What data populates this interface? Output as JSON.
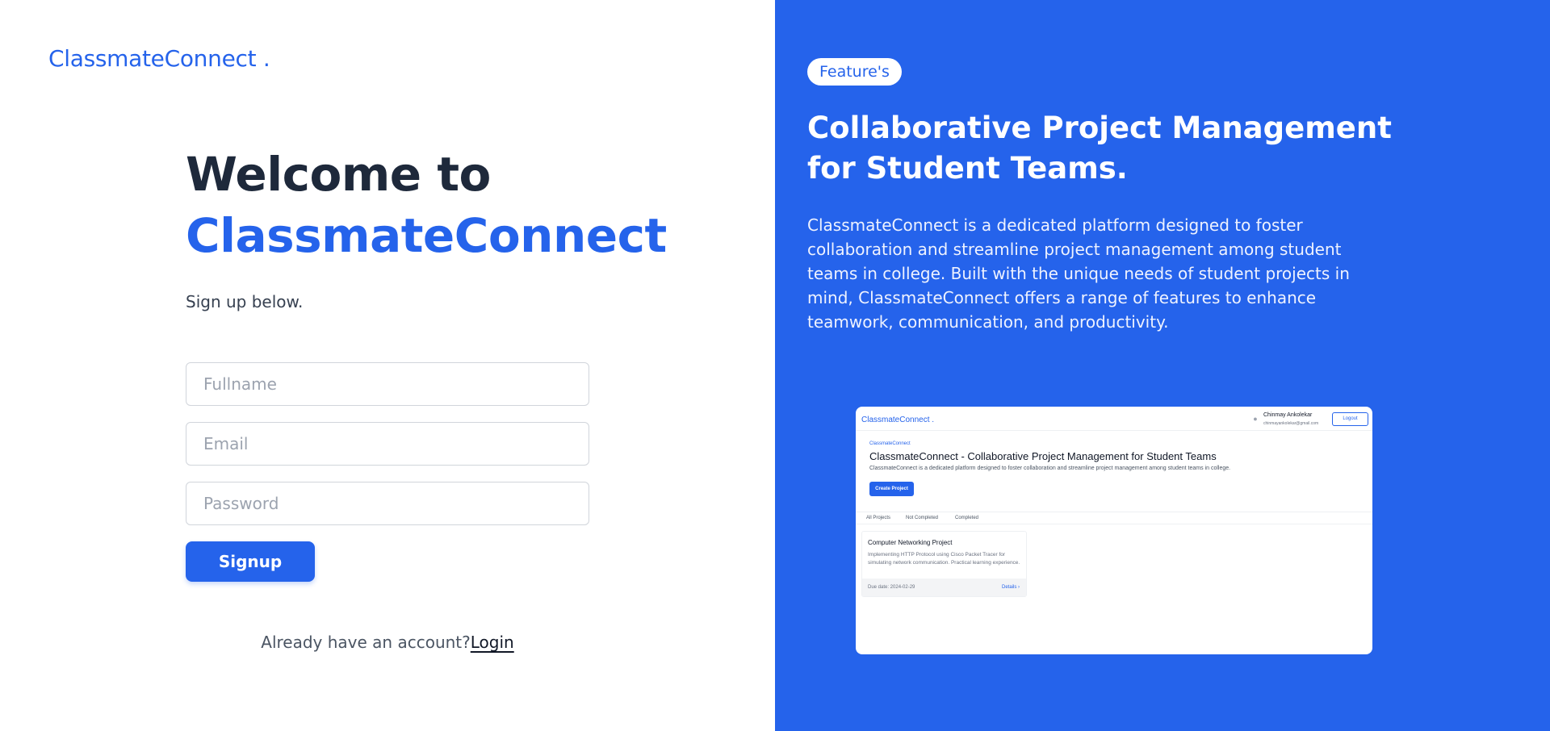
{
  "brand": "ClassmateConnect .",
  "left": {
    "welcome_line1": "Welcome to",
    "welcome_line2": "ClassmateConnect",
    "subtitle": "Sign up below.",
    "fields": {
      "fullname_placeholder": "Fullname",
      "email_placeholder": "Email",
      "password_placeholder": "Password"
    },
    "signup_label": "Signup",
    "already_text": "Already have an account?",
    "login_label": "Login"
  },
  "right": {
    "badge": "Feature's",
    "title": "Collaborative Project Management for Student Teams.",
    "description": "ClassmateConnect is a dedicated platform designed to foster collaboration and streamline project management among student teams in college. Built with the unique needs of student projects in mind, ClassmateConnect offers a range of features to enhance teamwork, communication, and productivity.",
    "mockup": {
      "brand": "ClassmateConnect .",
      "user_name": "Chinmay Ankolekar",
      "user_email": "chinmayankolekar@gmail.com",
      "logout": "Logout",
      "crumb": "ClassmateConnect",
      "title": "ClassmateConnect - Collaborative Project Management for Student Teams",
      "description": "ClassmateConnect is a dedicated platform designed to foster collaboration and streamline project management among student teams in college.",
      "create_button": "Create Project",
      "tabs": [
        "All Projects",
        "Not Completed",
        "Completed"
      ],
      "card": {
        "title": "Computer Networking Project",
        "description": "Implementing HTTP Protocol using Cisco Packet Tracer for simulating network communication. Practical learning experience.",
        "due": "Due date: 2024-02-29",
        "details": "Details ›"
      }
    }
  },
  "colors": {
    "accent": "#2563eb",
    "text_dark": "#1e293b",
    "white": "#ffffff"
  }
}
